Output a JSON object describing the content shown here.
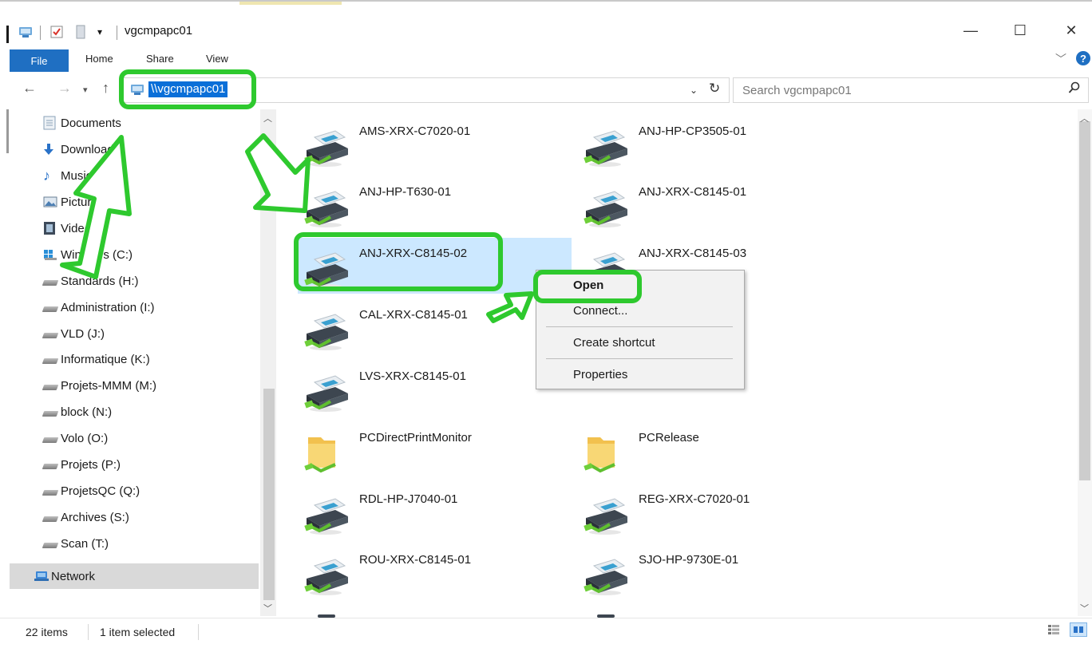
{
  "window": {
    "title": "vgcmpapc01",
    "controls": {
      "minimize": "—",
      "maximize": "☐",
      "close": "✕"
    }
  },
  "ribbon": {
    "tabs": [
      "File",
      "Home",
      "Share",
      "View"
    ],
    "help_icon": "?"
  },
  "address": {
    "path": "\\\\vgcmpapc01",
    "search_placeholder": "Search vgcmpapc01"
  },
  "nav": {
    "items": [
      {
        "label": "Documents",
        "icon": "documents-icon"
      },
      {
        "label": "Downloads",
        "icon": "downloads-icon"
      },
      {
        "label": "Music",
        "icon": "music-icon"
      },
      {
        "label": "Pictures",
        "icon": "pictures-icon"
      },
      {
        "label": "Videos",
        "icon": "videos-icon"
      },
      {
        "label": "Windows (C:)",
        "icon": "windows-drive-icon"
      },
      {
        "label": "Standards (H:)",
        "icon": "network-drive-icon"
      },
      {
        "label": "Administration (I:)",
        "icon": "network-drive-icon"
      },
      {
        "label": "VLD (J:)",
        "icon": "network-drive-icon"
      },
      {
        "label": "Informatique (K:)",
        "icon": "network-drive-icon"
      },
      {
        "label": "Projets-MMM (M:)",
        "icon": "network-drive-icon"
      },
      {
        "label": "block (N:)",
        "icon": "network-drive-icon"
      },
      {
        "label": "Volo (O:)",
        "icon": "network-drive-icon"
      },
      {
        "label": "Projets (P:)",
        "icon": "network-drive-icon"
      },
      {
        "label": "ProjetsQC (Q:)",
        "icon": "network-drive-icon"
      },
      {
        "label": "Archives (S:)",
        "icon": "network-drive-icon"
      },
      {
        "label": "Scan (T:)",
        "icon": "network-drive-icon"
      }
    ],
    "network": "Network"
  },
  "content": {
    "items": [
      {
        "label": "AMS-XRX-C7020-01",
        "type": "printer"
      },
      {
        "label": "ANJ-HP-CP3505-01",
        "type": "printer"
      },
      {
        "label": "ANJ-HP-T630-01",
        "type": "printer"
      },
      {
        "label": "ANJ-XRX-C8145-01",
        "type": "printer"
      },
      {
        "label": "ANJ-XRX-C8145-02",
        "type": "printer",
        "selected": true
      },
      {
        "label": "ANJ-XRX-C8145-03",
        "type": "printer"
      },
      {
        "label": "CAL-XRX-C8145-01",
        "type": "printer"
      },
      {
        "label": "",
        "type": "hidden"
      },
      {
        "label": "LVS-XRX-C8145-01",
        "type": "printer"
      },
      {
        "label": "",
        "type": "folder-partial"
      },
      {
        "label": "PCDirectPrintMonitor",
        "type": "folder"
      },
      {
        "label": "PCRelease",
        "type": "folder"
      },
      {
        "label": "RDL-HP-J7040-01",
        "type": "printer"
      },
      {
        "label": "REG-XRX-C7020-01",
        "type": "printer"
      },
      {
        "label": "ROU-XRX-C8145-01",
        "type": "printer"
      },
      {
        "label": "SJO-HP-9730E-01",
        "type": "printer"
      }
    ]
  },
  "context_menu": {
    "items": [
      "Open",
      "Connect...",
      "Create shortcut",
      "Properties"
    ]
  },
  "status": {
    "count": "22 items",
    "selection": "1 item selected"
  },
  "colors": {
    "accent_blue": "#1f6fc2",
    "selection": "#cce8ff",
    "annotation_green": "#2ec92e"
  }
}
